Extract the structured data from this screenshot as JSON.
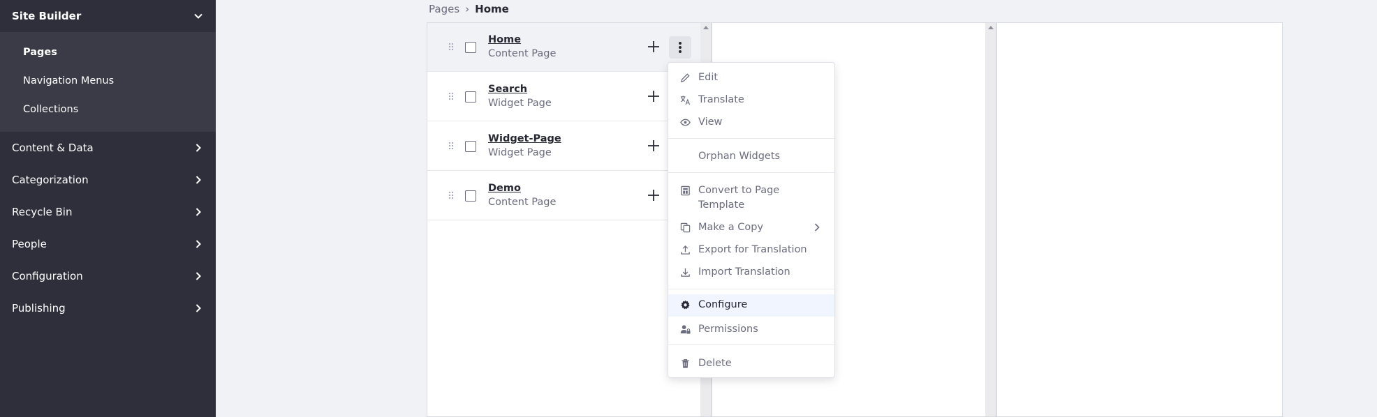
{
  "sidebar": {
    "title": "Site Builder",
    "sub_items": [
      {
        "label": "Pages",
        "active": true
      },
      {
        "label": "Navigation Menus"
      },
      {
        "label": "Collections"
      }
    ],
    "categories": [
      {
        "label": "Content & Data"
      },
      {
        "label": "Categorization"
      },
      {
        "label": "Recycle Bin"
      },
      {
        "label": "People"
      },
      {
        "label": "Configuration"
      },
      {
        "label": "Publishing"
      }
    ]
  },
  "breadcrumb": {
    "parent": "Pages",
    "separator": "›",
    "current": "Home"
  },
  "pages": [
    {
      "name": "Home",
      "type": "Content Page"
    },
    {
      "name": "Search",
      "type": "Widget Page"
    },
    {
      "name": "Widget-Page",
      "type": "Widget Page"
    },
    {
      "name": "Demo",
      "type": "Content Page"
    }
  ],
  "menu": {
    "edit": "Edit",
    "translate": "Translate",
    "view": "View",
    "orphan_widgets": "Orphan Widgets",
    "convert": "Convert to Page Template",
    "make_copy": "Make a Copy",
    "export_translation": "Export for Translation",
    "import_translation": "Import Translation",
    "configure": "Configure",
    "permissions": "Permissions",
    "delete": "Delete"
  },
  "colors": {
    "sidebar_bg": "#2e2f3b",
    "sidebar_sub_bg": "#3a3b47",
    "page_bg": "#f1f2f5",
    "highlight": "#f0f5ff"
  }
}
